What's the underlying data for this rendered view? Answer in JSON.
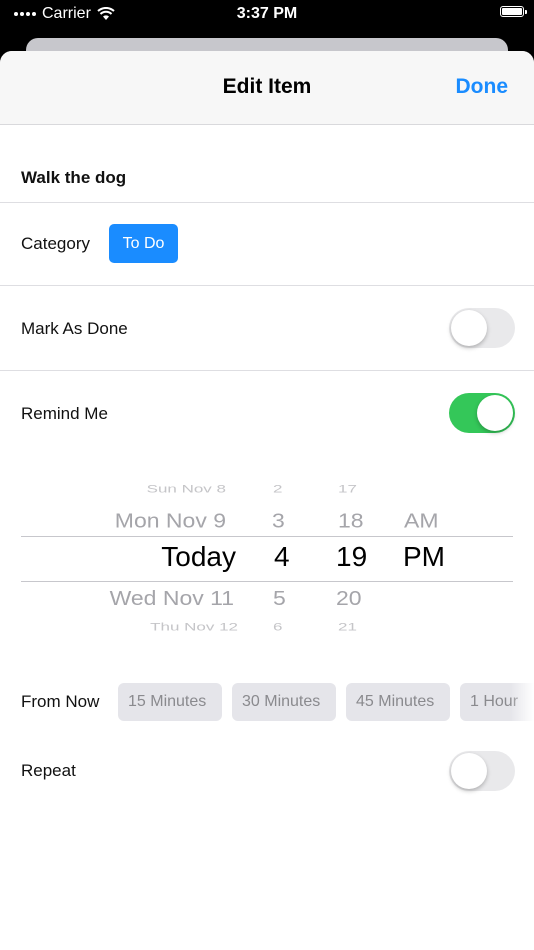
{
  "status_bar": {
    "carrier": "Carrier",
    "time": "3:37 PM"
  },
  "navbar": {
    "title": "Edit Item",
    "done_label": "Done"
  },
  "item": {
    "title": "Walk the dog"
  },
  "category": {
    "label": "Category",
    "value": "To Do"
  },
  "mark_done": {
    "label": "Mark As Done",
    "on": false
  },
  "remind": {
    "label": "Remind Me",
    "on": true
  },
  "picker": {
    "dates": [
      "Sun Nov 8",
      "Mon Nov 9",
      "Today",
      "Wed Nov 11",
      "Thu Nov 12"
    ],
    "hours": [
      "2",
      "3",
      "4",
      "5",
      "6"
    ],
    "minutes": [
      "17",
      "18",
      "19",
      "20",
      "21"
    ],
    "ampm": [
      "AM",
      "PM"
    ]
  },
  "from_now": {
    "label": "From Now",
    "options": [
      "15 Minutes",
      "30 Minutes",
      "45 Minutes",
      "1 Hour"
    ]
  },
  "repeat": {
    "label": "Repeat",
    "on": false
  },
  "colors": {
    "accent": "#1a8cff",
    "toggle_on": "#34c759"
  }
}
